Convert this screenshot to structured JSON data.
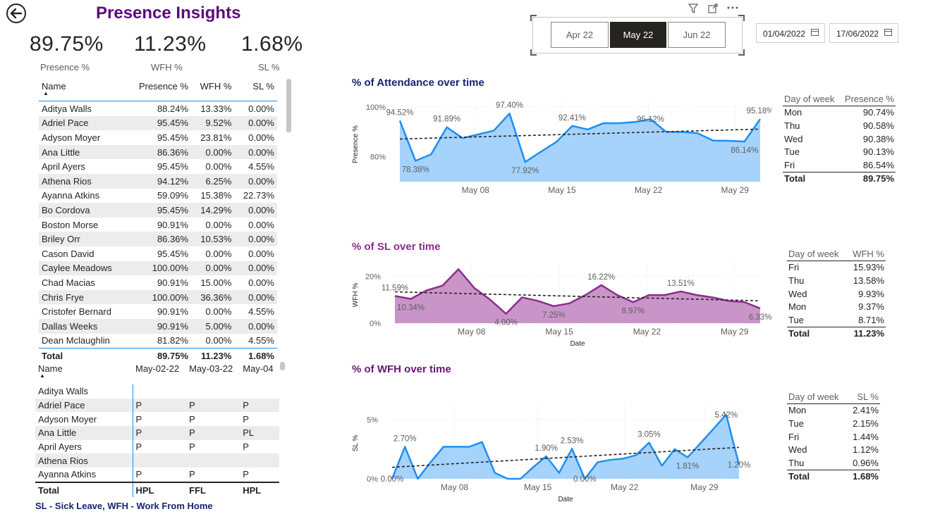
{
  "header": {
    "title": "Presence Insights",
    "back_icon": "back-arrow-icon"
  },
  "kpis": [
    {
      "value": "89.75%",
      "label": "Presence %"
    },
    {
      "value": "11.23%",
      "label": "WFH %"
    },
    {
      "value": "1.68%",
      "label": "SL %"
    }
  ],
  "summary_table": {
    "columns": [
      "Name",
      "Presence %",
      "WFH %",
      "SL %"
    ],
    "rows": [
      [
        "Aditya Walls",
        "88.24%",
        "13.33%",
        "0.00%"
      ],
      [
        "Adriel Pace",
        "95.45%",
        "9.52%",
        "0.00%"
      ],
      [
        "Adyson Moyer",
        "95.45%",
        "23.81%",
        "0.00%"
      ],
      [
        "Ana Little",
        "86.36%",
        "0.00%",
        "0.00%"
      ],
      [
        "April Ayers",
        "95.45%",
        "0.00%",
        "4.55%"
      ],
      [
        "Athena Rios",
        "94.12%",
        "6.25%",
        "0.00%"
      ],
      [
        "Ayanna Atkins",
        "59.09%",
        "15.38%",
        "22.73%"
      ],
      [
        "Bo Cordova",
        "95.45%",
        "14.29%",
        "0.00%"
      ],
      [
        "Boston Morse",
        "90.91%",
        "0.00%",
        "0.00%"
      ],
      [
        "Briley Orr",
        "86.36%",
        "10.53%",
        "0.00%"
      ],
      [
        "Cason David",
        "95.45%",
        "0.00%",
        "0.00%"
      ],
      [
        "Caylee Meadows",
        "100.00%",
        "0.00%",
        "0.00%"
      ],
      [
        "Chad Macias",
        "90.91%",
        "15.00%",
        "0.00%"
      ],
      [
        "Chris Frye",
        "100.00%",
        "36.36%",
        "0.00%"
      ],
      [
        "Cristofer Bernard",
        "90.91%",
        "0.00%",
        "4.55%"
      ],
      [
        "Dallas Weeks",
        "90.91%",
        "5.00%",
        "0.00%"
      ],
      [
        "Dean Mclaughlin",
        "81.82%",
        "0.00%",
        "4.55%"
      ]
    ],
    "total": [
      "Total",
      "89.75%",
      "11.23%",
      "1.68%"
    ]
  },
  "matrix_table": {
    "columns": [
      "Name",
      "May-02-22",
      "May-03-22",
      "May-04"
    ],
    "rows": [
      [
        "Aditya Walls",
        "",
        "",
        ""
      ],
      [
        "Adriel Pace",
        "P",
        "P",
        "P"
      ],
      [
        "Adyson Moyer",
        "P",
        "P",
        "P"
      ],
      [
        "Ana Little",
        "P",
        "P",
        "PL"
      ],
      [
        "April Ayers",
        "P",
        "P",
        "P"
      ],
      [
        "Athena Rios",
        "",
        "",
        ""
      ],
      [
        "Ayanna Atkins",
        "P",
        "P",
        "P"
      ]
    ],
    "total": [
      "Total",
      "HPL",
      "FFL",
      "HPL"
    ]
  },
  "footnote": "SL - Sick Leave, WFH - Work From Home",
  "toolbar": {
    "filter_icon": "filter-icon",
    "focus_icon": "focus-mode-icon",
    "more_icon": "more-options-icon"
  },
  "month_slicer": {
    "options": [
      "Apr 22",
      "May 22",
      "Jun 22"
    ],
    "selected": "May 22"
  },
  "date_range": {
    "start": "01/04/2022",
    "end": "17/06/2022"
  },
  "dow_tables": {
    "presence": {
      "headers": [
        "Day of week",
        "Presence %"
      ],
      "rows": [
        [
          "Mon",
          "90.74%"
        ],
        [
          "Thu",
          "90.58%"
        ],
        [
          "Wed",
          "90.38%"
        ],
        [
          "Tue",
          "90.13%"
        ],
        [
          "Fri",
          "86.54%"
        ]
      ],
      "total": [
        "Total",
        "89.75%"
      ]
    },
    "wfh": {
      "headers": [
        "Day of week",
        "WFH %"
      ],
      "rows": [
        [
          "Fri",
          "15.93%"
        ],
        [
          "Thu",
          "13.58%"
        ],
        [
          "Wed",
          "9.93%"
        ],
        [
          "Mon",
          "9.37%"
        ],
        [
          "Tue",
          "8.71%"
        ]
      ],
      "total": [
        "Total",
        "11.23%"
      ]
    },
    "sl": {
      "headers": [
        "Day of week",
        "SL %"
      ],
      "rows": [
        [
          "Mon",
          "2.41%"
        ],
        [
          "Tue",
          "2.15%"
        ],
        [
          "Fri",
          "1.44%"
        ],
        [
          "Wed",
          "1.12%"
        ],
        [
          "Thu",
          "0.96%"
        ]
      ],
      "total": [
        "Total",
        "1.68%"
      ]
    }
  },
  "colors": {
    "title_purple": "#5b0b7a",
    "chart_blue": "#1e8ff0",
    "blue_fill": "#a6d3fb",
    "purple_line": "#8b2d8e",
    "purple_fill": "#c995c9",
    "navy": "#14256e"
  },
  "chart_data": [
    {
      "type": "area",
      "title": "% of Attendance over time",
      "ylabel": "Presence %",
      "xlabel": "",
      "yticks": [
        "100%",
        "80%"
      ],
      "xticks": [
        "May 08",
        "May 15",
        "May 22",
        "May 29"
      ],
      "ylim": [
        70,
        100
      ],
      "x": [
        "May 02",
        "May 03",
        "May 04",
        "May 05",
        "May 06",
        "May 08",
        "May 10",
        "May 11",
        "May 12",
        "May 15",
        "May 16",
        "May 17",
        "May 18",
        "May 19",
        "May 20",
        "May 22",
        "May 23",
        "May 24",
        "May 25",
        "May 26",
        "May 27",
        "May 29",
        "May 30",
        "May 31"
      ],
      "y": [
        94.52,
        78.38,
        81.0,
        91.89,
        87.5,
        89.0,
        90.5,
        97.4,
        77.92,
        82.0,
        86.0,
        92.41,
        91.0,
        93.5,
        93.5,
        94.0,
        95.12,
        90.0,
        90.0,
        89.5,
        86.5,
        86.4,
        86.14,
        95.18
      ],
      "data_labels": [
        "94.52%",
        "78.38%",
        "91.89%",
        "97.40%",
        "77.92%",
        "92.41%",
        "95.12%",
        "86.14%",
        "95.18%"
      ],
      "trendline": true
    },
    {
      "type": "area",
      "title": "% of SL over time",
      "ylabel": "WFH %",
      "xlabel": "Date",
      "yticks": [
        "20%",
        "0%"
      ],
      "xticks": [
        "May 08",
        "May 15",
        "May 22",
        "May 29"
      ],
      "ylim": [
        0,
        24
      ],
      "x": [
        "May 02",
        "May 03",
        "May 04",
        "May 05",
        "May 06",
        "May 08",
        "May 10",
        "May 11",
        "May 12",
        "May 15",
        "May 16",
        "May 17",
        "May 18",
        "May 19",
        "May 20",
        "May 22",
        "May 23",
        "May 24",
        "May 25",
        "May 26",
        "May 27",
        "May 29",
        "May 30",
        "May 31"
      ],
      "y": [
        11.59,
        10.34,
        14.0,
        16.0,
        23.0,
        15.0,
        10.0,
        4.0,
        11.0,
        9.5,
        7.25,
        8.5,
        12.0,
        16.22,
        12.0,
        8.97,
        12.0,
        12.0,
        13.51,
        12.0,
        11.0,
        9.5,
        9.0,
        6.33
      ],
      "data_labels": [
        "11.59%",
        "10.34%",
        "4.00%",
        "7.25%",
        "16.22%",
        "8.97%",
        "13.51%",
        "6.33%"
      ],
      "trendline": true
    },
    {
      "type": "area",
      "title": "% of WFH over time",
      "ylabel": "SL %",
      "xlabel": "Date",
      "yticks": [
        "5%",
        "0%"
      ],
      "xticks": [
        "May 08",
        "May 15",
        "May 22",
        "May 29"
      ],
      "ylim": [
        0,
        6
      ],
      "x": [
        "May 02",
        "May 03",
        "May 04",
        "May 05",
        "May 06",
        "May 08",
        "May 10",
        "May 11",
        "May 12",
        "May 15",
        "May 16",
        "May 17",
        "May 18",
        "May 19",
        "May 20",
        "May 22",
        "May 23",
        "May 24",
        "May 25",
        "May 26",
        "May 27",
        "May 29",
        "May 30",
        "May 31"
      ],
      "y": [
        0.0,
        2.7,
        0.0,
        1.4,
        2.7,
        2.7,
        2.7,
        3.1,
        0.5,
        0.0,
        0.0,
        1.0,
        1.9,
        0.5,
        2.53,
        0.0,
        1.4,
        1.6,
        1.7,
        2.0,
        3.05,
        1.1,
        2.5,
        1.81,
        3.0,
        4.2,
        5.42,
        1.2
      ],
      "data_labels": [
        "0.00%",
        "2.70%",
        "1.90%",
        "2.53%",
        "0.00%",
        "3.05%",
        "1.81%",
        "5.42%",
        "1.20%"
      ],
      "trendline": true
    }
  ]
}
